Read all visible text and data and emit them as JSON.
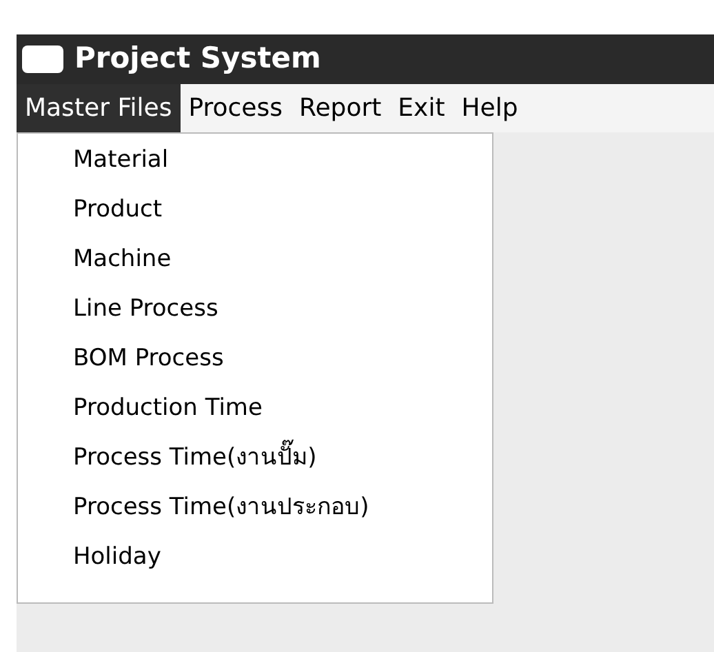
{
  "window": {
    "title": "Project System"
  },
  "menu_bar": [
    {
      "label": "Master Files",
      "selected": true
    },
    {
      "label": "Process",
      "selected": false
    },
    {
      "label": "Report",
      "selected": false
    },
    {
      "label": "Exit",
      "selected": false
    },
    {
      "label": "Help",
      "selected": false
    }
  ],
  "dropdown": {
    "items": [
      "Material",
      "Product",
      "Machine",
      "Line Process",
      "BOM Process",
      "Production Time",
      "Process Time(งานปั๊ม)",
      "Process Time(งานประกอบ)",
      "Holiday"
    ]
  }
}
